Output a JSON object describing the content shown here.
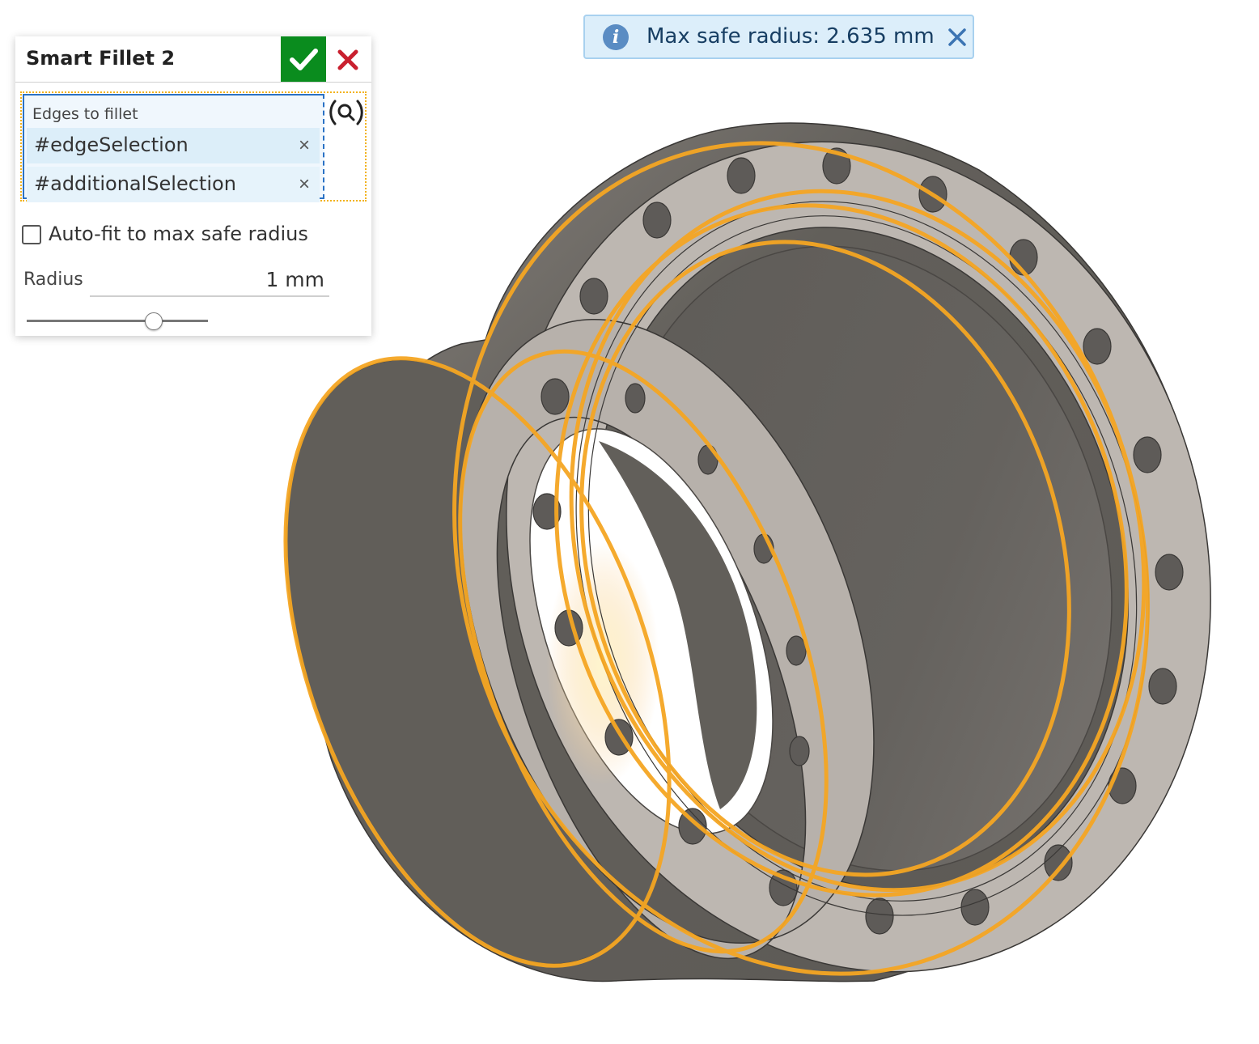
{
  "dialog": {
    "title": "Smart Fillet 2",
    "accept_icon": "checkmark-icon",
    "cancel_icon": "close-icon",
    "selection_label": "Edges to fillet",
    "selections": [
      "#edgeSelection",
      "#additionalSelection"
    ],
    "remove_glyph": "×",
    "search_icon": "search-icon",
    "auto_fit_label": "Auto-fit to max safe radius",
    "auto_fit_checked": false,
    "radius_label": "Radius",
    "radius_value": "1 mm",
    "slider_fraction": 0.7
  },
  "toast": {
    "icon": "info-icon",
    "icon_glyph": "i",
    "message": "Max safe radius: 2.635 mm",
    "close_icon": "close-icon"
  },
  "viewport": {
    "part": "flanged-pipe-fitting",
    "highlight_color": "#f5a623",
    "body_color": "#615e59",
    "face_color": "#bdb7b1"
  }
}
